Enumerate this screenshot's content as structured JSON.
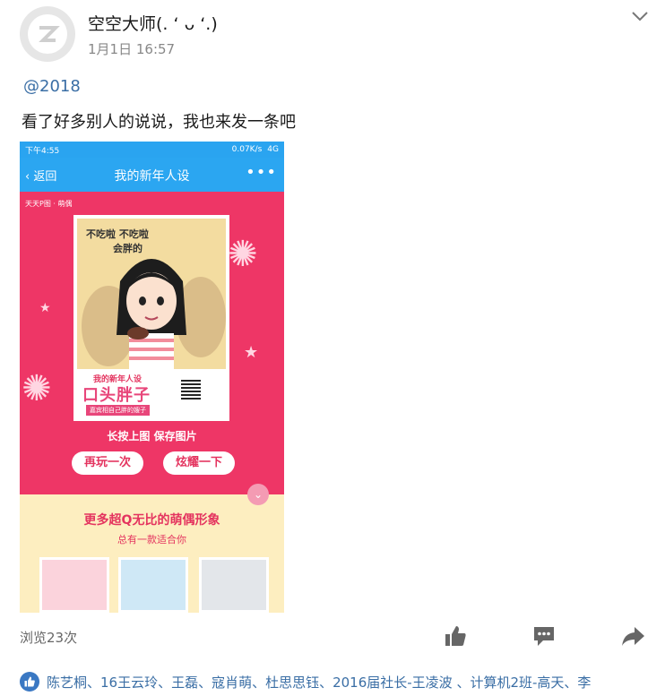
{
  "post": {
    "username": "空空大师(. ‘ ᴗ ‘.)",
    "time": "1月1日 16:57",
    "mention": "@2018",
    "text": "看了好多别人的说说，我也来发一条吧"
  },
  "screenshot": {
    "status_time": "下午4:55",
    "status_right": [
      "0.07K/s",
      "4G"
    ],
    "back_label": "返回",
    "title": "我的新年人设",
    "brand": "天天P图 · 萌偶",
    "bubble_lines": [
      "不吃啦 不吃啦",
      "会胖的"
    ],
    "card_title_small": "我的新年人设",
    "card_title_big": "口头胖子",
    "card_subtitle": "嘉宾相自己胖的嫂子",
    "save_hint": "长按上图 保存图片",
    "btn_again": "再玩一次",
    "btn_show": "炫耀一下",
    "promo_title": "更多超Q无比的萌偶形象",
    "promo_sub": "总有一款适合你"
  },
  "footer": {
    "views": "浏览23次",
    "likes": "陈艺桐、16王云玲、王磊、寇肖萌、杜思思钰、2016届社长-王凌波 、计算机2班-高天、李"
  },
  "icons": {
    "more": "chevron-down-icon",
    "like": "thumbs-up-icon",
    "comment": "comment-icon",
    "share": "share-arrow-icon"
  },
  "colors": {
    "link": "#3a6ea5",
    "nav_blue": "#2ba6f1",
    "pink": "#ee3666",
    "icon_gray": "#666666"
  }
}
